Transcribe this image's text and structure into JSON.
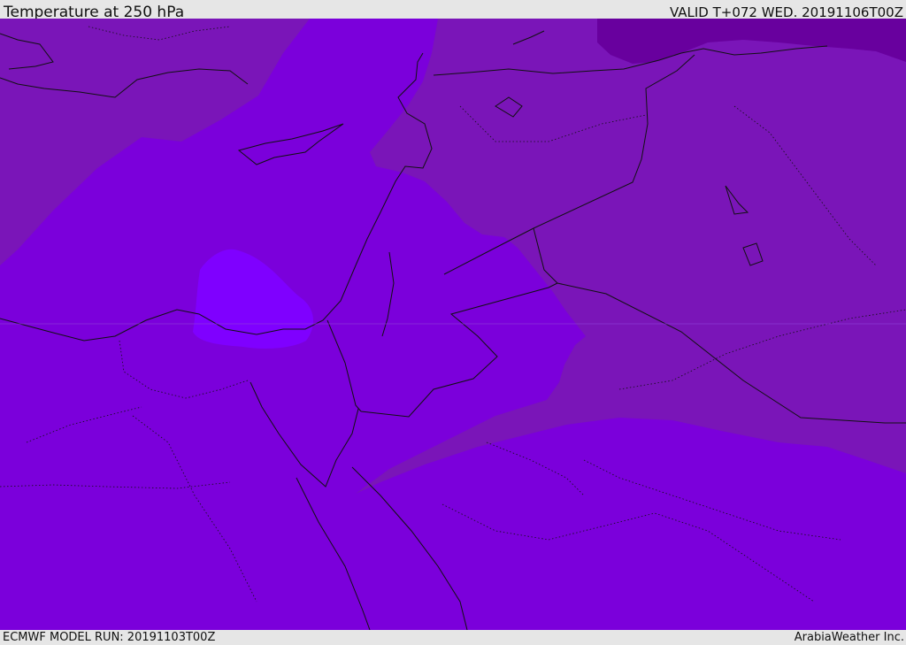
{
  "header": {
    "title": "Temperature at 250 hPa",
    "valid": "VALID T+072 WED. 20191106T00Z"
  },
  "footer": {
    "model_run": "ECMWF MODEL RUN: 20191103T00Z",
    "credit": "ArabiaWeather Inc."
  },
  "map": {
    "palette": {
      "base": "#7b00db",
      "warmer_band": "#7a15b8",
      "coldest_core": "#68009e",
      "warm_pocket": "#7f00ff",
      "border_color": "#111111"
    }
  }
}
